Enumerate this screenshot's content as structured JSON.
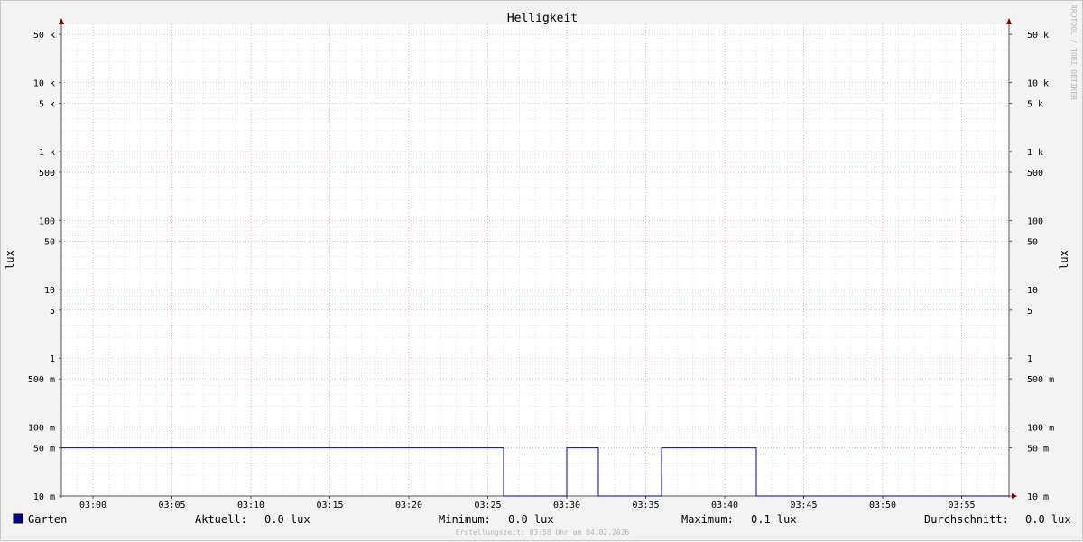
{
  "chart_data": {
    "type": "line",
    "title": "Helligkeit",
    "ylabel": "lux",
    "ylabel_right": "lux",
    "y_scale": "log",
    "ylim": [
      0.01,
      70000
    ],
    "y_ticks": [
      {
        "value": 50000,
        "label": "50 k"
      },
      {
        "value": 10000,
        "label": "10 k"
      },
      {
        "value": 5000,
        "label": "5 k"
      },
      {
        "value": 1000,
        "label": "1 k"
      },
      {
        "value": 500,
        "label": "500"
      },
      {
        "value": 100,
        "label": "100"
      },
      {
        "value": 50,
        "label": "50"
      },
      {
        "value": 10,
        "label": "10"
      },
      {
        "value": 5,
        "label": "5"
      },
      {
        "value": 1,
        "label": "1"
      },
      {
        "value": 0.5,
        "label": "500 m"
      },
      {
        "value": 0.1,
        "label": "100 m"
      },
      {
        "value": 0.05,
        "label": "50 m"
      },
      {
        "value": 0.01,
        "label": "10 m"
      }
    ],
    "x_ticks": [
      "03:00",
      "03:05",
      "03:10",
      "03:15",
      "03:20",
      "03:25",
      "03:30",
      "03:35",
      "03:40",
      "03:45",
      "03:50",
      "03:55"
    ],
    "xlim": [
      "02:58",
      "03:58"
    ],
    "grid": true,
    "series": [
      {
        "name": "Garten",
        "color": "#00009c",
        "points": [
          [
            "02:58",
            0.05
          ],
          [
            "03:26",
            0.05
          ],
          [
            "03:26",
            0.01
          ],
          [
            "03:30",
            0.01
          ],
          [
            "03:30",
            0.05
          ],
          [
            "03:32",
            0.05
          ],
          [
            "03:32",
            0.01
          ],
          [
            "03:36",
            0.01
          ],
          [
            "03:36",
            0.05
          ],
          [
            "03:42",
            0.05
          ],
          [
            "03:42",
            0.01
          ],
          [
            "03:58",
            0.01
          ]
        ]
      }
    ],
    "legend": {
      "series_name": "Garten",
      "swatch_color": "#00009c",
      "stats": [
        {
          "label": "Aktuell:",
          "value": "0.0 lux"
        },
        {
          "label": "Minimum:",
          "value": "0.0 lux"
        },
        {
          "label": "Maximum:",
          "value": "0.1 lux"
        },
        {
          "label": "Durchschnitt:",
          "value": "0.0 lux"
        }
      ]
    },
    "footer": "Erstellungszeit: 03:58 Uhr am 04.02.2026",
    "watermark": "RRDTOOL / TOBI OETIKER"
  }
}
